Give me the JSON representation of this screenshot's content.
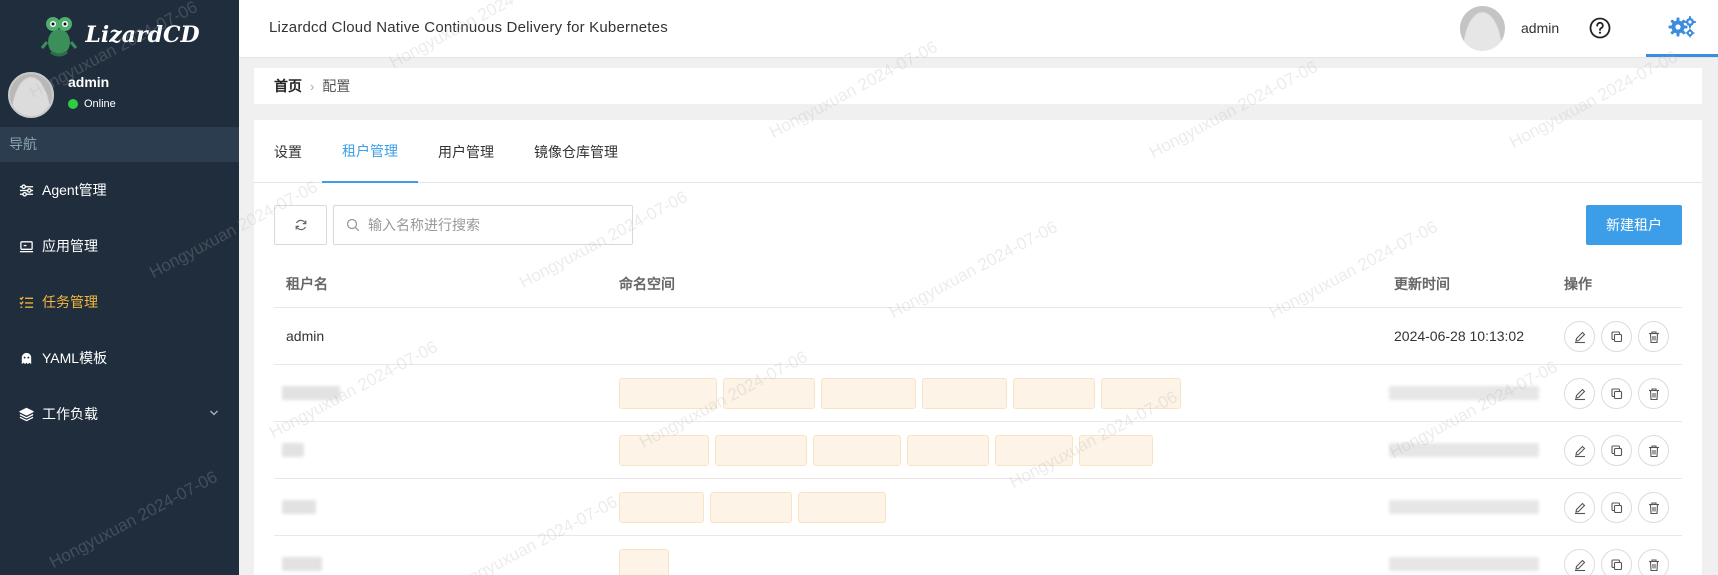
{
  "app": {
    "logo_text": "LizardCD",
    "header_title": "Lizardcd Cloud Native Continuous Delivery for Kubernetes",
    "header_user": "admin"
  },
  "sidebar": {
    "user_name": "admin",
    "user_status": "Online",
    "nav_header": "导航",
    "items": [
      {
        "label": "Agent管理",
        "icon": "sliders-icon"
      },
      {
        "label": "应用管理",
        "icon": "monitor-icon"
      },
      {
        "label": "任务管理",
        "icon": "task-list-icon"
      },
      {
        "label": "YAML模板",
        "icon": "ghost-icon"
      },
      {
        "label": "工作负载",
        "icon": "layers-icon"
      }
    ]
  },
  "breadcrumb": {
    "home": "首页",
    "current": "配置"
  },
  "tabs": [
    "设置",
    "租户管理",
    "用户管理",
    "镜像仓库管理"
  ],
  "toolbar": {
    "search_placeholder": "输入名称进行搜索",
    "new_button": "新建租户"
  },
  "table": {
    "columns": [
      "租户名",
      "命名空间",
      "更新时间",
      "操作"
    ],
    "rows": [
      {
        "name": "admin",
        "updated": "2024-06-28 10:13:02"
      }
    ]
  },
  "watermark": "Hongyuxuan 2024-07-06",
  "colors": {
    "sidebar_bg": "#1f2d3d",
    "accent": "#3c9ee8",
    "active_nav": "#f5b83d",
    "tag_bg": "#fdf3e6"
  }
}
